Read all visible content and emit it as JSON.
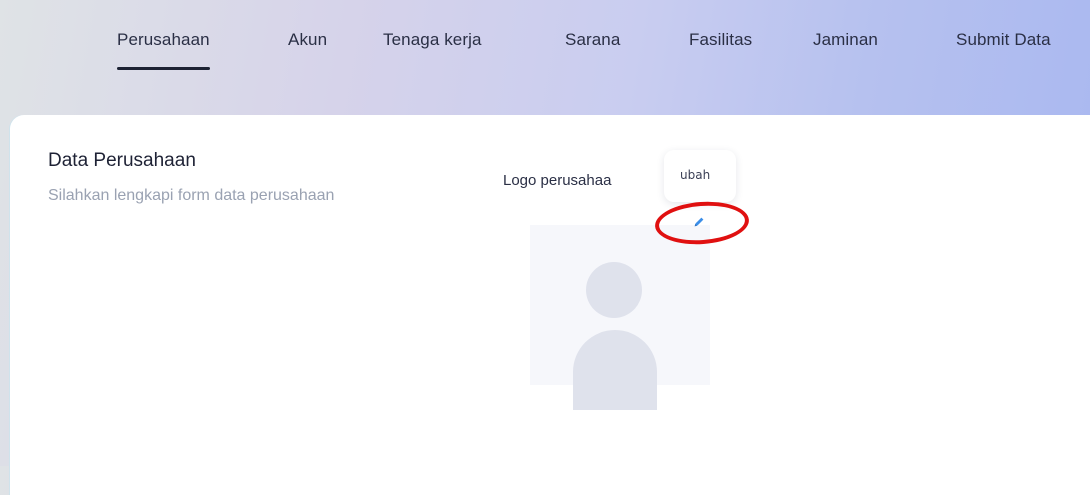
{
  "tabs": [
    {
      "label": "Perusahaan",
      "active": true
    },
    {
      "label": "Akun",
      "active": false
    },
    {
      "label": "Tenaga kerja",
      "active": false
    },
    {
      "label": "Sarana",
      "active": false
    },
    {
      "label": "Fasilitas",
      "active": false
    },
    {
      "label": "Jaminan",
      "active": false
    },
    {
      "label": "Submit Data",
      "active": false
    }
  ],
  "card": {
    "title": "Data Perusahaan",
    "subtitle": "Silahkan lengkapi form data perusahaan"
  },
  "logo": {
    "label": "Logo perusahaa",
    "tooltip": "ubah",
    "edit_icon": "pencil-icon",
    "placeholder_icon": "avatar-placeholder-icon"
  },
  "colors": {
    "highlight_circle": "#e01010",
    "edit_icon": "#3b8ee8"
  }
}
